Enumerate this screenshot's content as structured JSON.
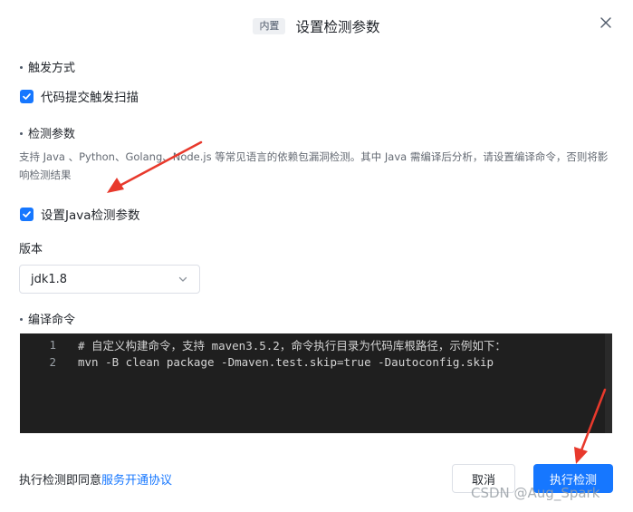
{
  "dialog": {
    "tag": "内置",
    "title": "设置检测参数"
  },
  "trigger": {
    "section_title": "触发方式",
    "checkbox_label": "代码提交触发扫描",
    "checked": true
  },
  "params": {
    "section_title": "检测参数",
    "description": "支持 Java 、Python、Golang、Node.js 等常见语言的依赖包漏洞检测。其中 Java 需编译后分析，请设置编译命令，否则将影响检测结果",
    "java_checkbox_label": "设置Java检测参数",
    "java_checked": true
  },
  "version": {
    "label": "版本",
    "selected": "jdk1.8"
  },
  "compile": {
    "section_title": "编译命令",
    "lines": [
      {
        "no": "1",
        "code": "# 自定义构建命令，支持 maven3.5.2，命令执行目录为代码库根路径，示例如下："
      },
      {
        "no": "2",
        "code": "mvn -B clean package -Dmaven.test.skip=true -Dautoconfig.skip"
      }
    ]
  },
  "footer": {
    "agree_text": "执行检测即同意",
    "agree_link": "服务开通协议",
    "cancel_label": "取消",
    "run_label": "执行检测"
  },
  "watermark": "CSDN @Aug_Spark",
  "colors": {
    "primary": "#1677ff",
    "annotation_arrow": "#e8392c"
  }
}
